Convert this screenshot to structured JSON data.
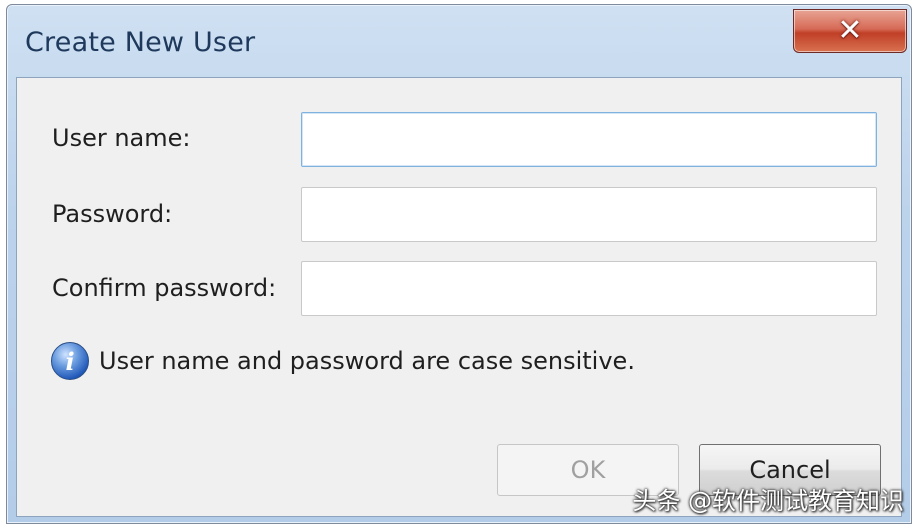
{
  "window": {
    "title": "Create New User",
    "close_glyph": "✕"
  },
  "form": {
    "username_label": "User name:",
    "username_value": "",
    "password_label": "Password:",
    "password_value": "",
    "confirm_label": "Confirm password:",
    "confirm_value": ""
  },
  "info": {
    "icon": "info-icon",
    "icon_glyph": "i",
    "text": "User name and password are case sensitive."
  },
  "buttons": {
    "ok_label": "OK",
    "ok_enabled": false,
    "cancel_label": "Cancel"
  },
  "watermark": {
    "text": "头条 @软件测试教育知识"
  },
  "colors": {
    "title_text": "#1e395b",
    "close_button": "#c03f27",
    "focus_border": "#7fb2de",
    "info_icon": "#1f57b8"
  }
}
